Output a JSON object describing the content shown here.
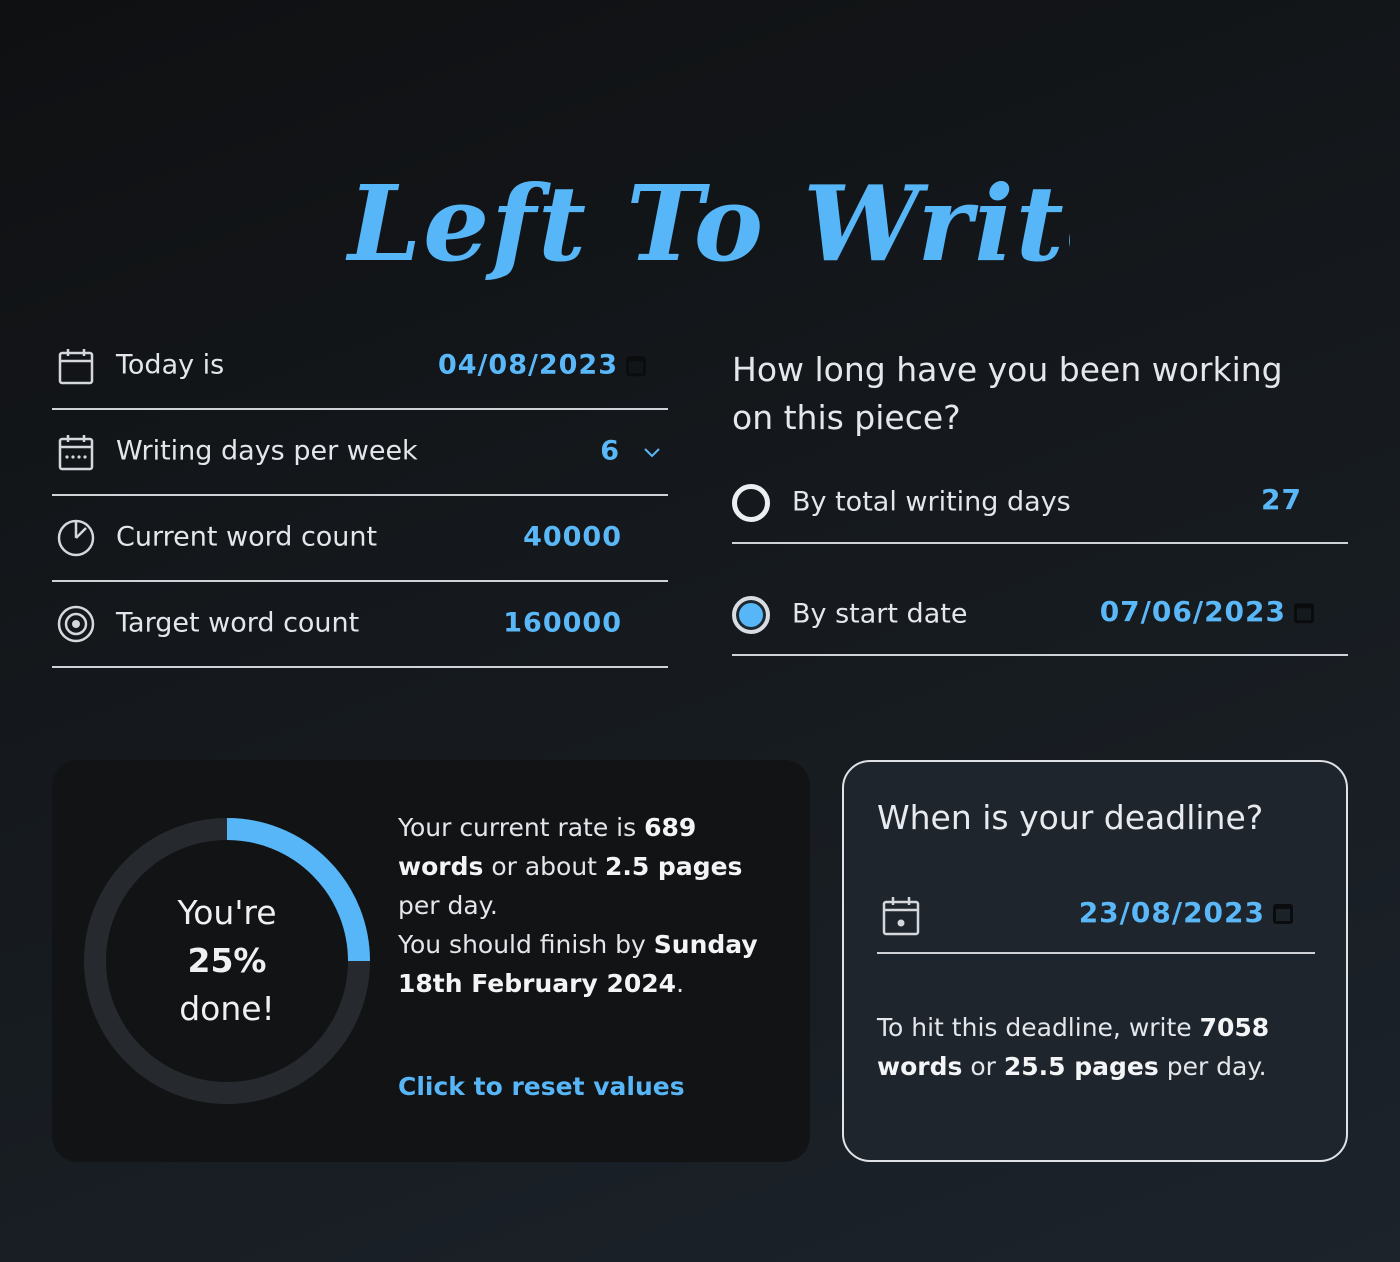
{
  "title": "Left To Write",
  "form": {
    "today": {
      "label": "Today is",
      "value": "04/08/2023"
    },
    "writing_days": {
      "label": "Writing days per week",
      "value": "6"
    },
    "current_words": {
      "label": "Current word count",
      "value": "40000"
    },
    "target_words": {
      "label": "Target word count",
      "value": "160000"
    }
  },
  "question": {
    "title": "How long have you been working on this piece?",
    "options": [
      {
        "label": "By total writing days",
        "value": "27",
        "selected": false
      },
      {
        "label": "By start date",
        "value": "07/06/2023",
        "selected": true
      }
    ]
  },
  "progress": {
    "percent": 25,
    "line1": "You're",
    "line2": "25%",
    "line3": "done!",
    "rate_prefix": "Your current rate is ",
    "rate_words": "689 words",
    "rate_middle": " or about ",
    "rate_pages": "2.5 pages",
    "rate_suffix": " per day.",
    "finish_prefix": "You should finish by ",
    "finish_date": "Sunday 18th February 2024",
    "finish_suffix": ".",
    "reset_label": "Click to reset values",
    "ring_color": "#56b6f7",
    "track_color": "#262a2f"
  },
  "deadline": {
    "title": "When is your deadline?",
    "value": "23/08/2023",
    "text_prefix": "To hit this deadline, write ",
    "words": "7058 words",
    "text_middle": " or ",
    "pages": "25.5 pages",
    "text_suffix": " per day."
  },
  "colors": {
    "accent": "#56b6f7"
  }
}
